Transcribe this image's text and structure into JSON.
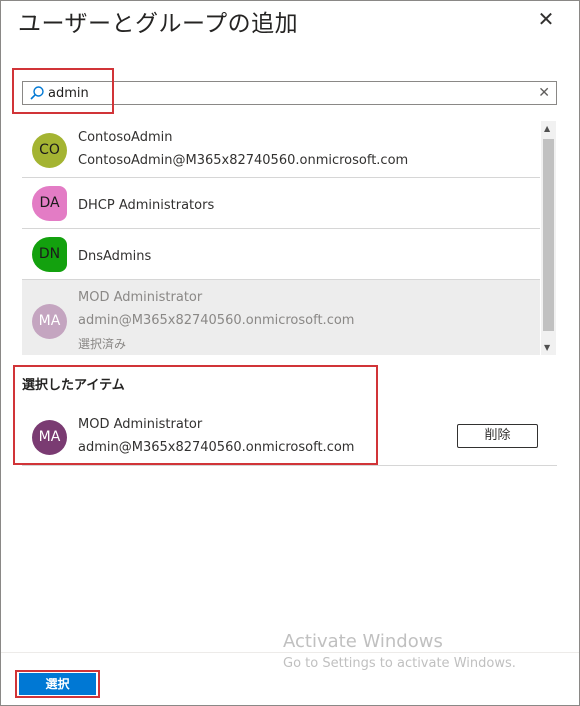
{
  "panel": {
    "title": "ユーザーとグループの追加",
    "close_icon": "close-icon"
  },
  "search": {
    "value": "admin",
    "placeholder": "",
    "icon": "search-icon",
    "clear_icon": "clear-icon",
    "clear_glyph": "✕"
  },
  "results": [
    {
      "initials": "CO",
      "avatar_color": "#a4b432",
      "name": "ContosoAdmin",
      "email": "ContosoAdmin@M365x82740560.onmicrosoft.com",
      "status": ""
    },
    {
      "initials": "DA",
      "avatar_color": "#e37cc5",
      "name": "DHCP Administrators",
      "email": "",
      "status": ""
    },
    {
      "initials": "DN",
      "avatar_color": "#13a10e",
      "name": "DnsAdmins",
      "email": "",
      "status": ""
    },
    {
      "initials": "MA",
      "avatar_color": "#c4a5c0",
      "name": "MOD Administrator",
      "email": "admin@M365x82740560.onmicrosoft.com",
      "status": "選択済み"
    }
  ],
  "selected_section": {
    "header": "選択したアイテム",
    "item": {
      "initials": "MA",
      "avatar_color": "#7a3b72",
      "name": "MOD Administrator",
      "email": "admin@M365x82740560.onmicrosoft.com"
    },
    "remove_label": "削除"
  },
  "watermark": {
    "line1": "Activate Windows",
    "line2": "Go to Settings to activate Windows."
  },
  "footer": {
    "select_label": "選択"
  },
  "colors": {
    "accent": "#0078d4",
    "highlight_box": "#d13438"
  }
}
